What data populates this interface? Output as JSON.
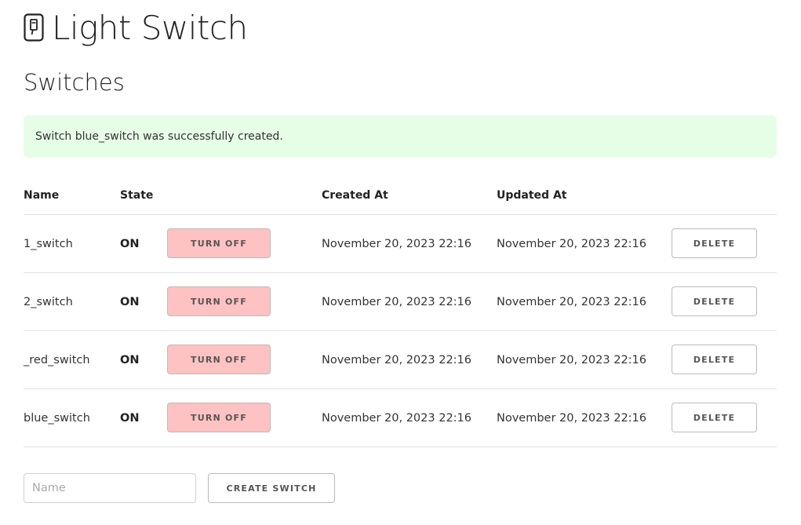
{
  "app": {
    "title": "Light Switch",
    "icon": "light-switch-icon"
  },
  "section": {
    "title": "Switches"
  },
  "flash": {
    "message": "Switch blue_switch was successfully created."
  },
  "table": {
    "headers": {
      "name": "Name",
      "state": "State",
      "created_at": "Created At",
      "updated_at": "Updated At"
    },
    "rows": [
      {
        "name": "1_switch",
        "state": "ON",
        "toggle_label": "TURN OFF",
        "created_at": "November 20, 2023 22:16",
        "updated_at": "November 20, 2023 22:16",
        "delete_label": "DELETE"
      },
      {
        "name": "2_switch",
        "state": "ON",
        "toggle_label": "TURN OFF",
        "created_at": "November 20, 2023 22:16",
        "updated_at": "November 20, 2023 22:16",
        "delete_label": "DELETE"
      },
      {
        "name": "_red_switch",
        "state": "ON",
        "toggle_label": "TURN OFF",
        "created_at": "November 20, 2023 22:16",
        "updated_at": "November 20, 2023 22:16",
        "delete_label": "DELETE"
      },
      {
        "name": "blue_switch",
        "state": "ON",
        "toggle_label": "TURN OFF",
        "created_at": "November 20, 2023 22:16",
        "updated_at": "November 20, 2023 22:16",
        "delete_label": "DELETE"
      }
    ]
  },
  "form": {
    "name_placeholder": "Name",
    "name_value": "",
    "create_label": "CREATE SWITCH"
  },
  "colors": {
    "flash_bg": "#e6fde6",
    "turn_off_bg": "#ffc2c2",
    "border": "#e1e1e1"
  }
}
